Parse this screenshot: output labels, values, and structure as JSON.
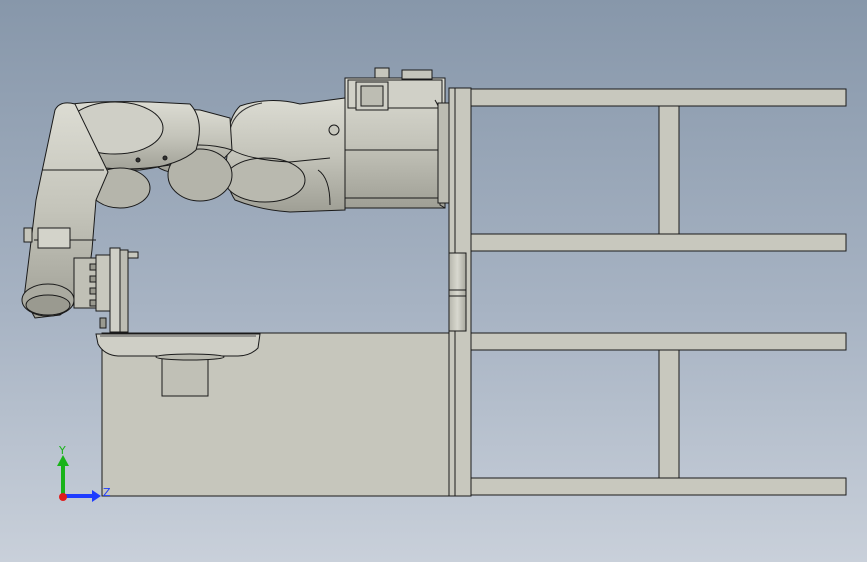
{
  "scene": {
    "description_free": true,
    "colors": {
      "background_top": "#8797aa",
      "background_bottom": "#c9d0da",
      "part_fill": "#c8c8be",
      "part_fill_light": "#d6d6cd",
      "part_shade": "#a9a99f",
      "edge": "#1a1a1a"
    }
  },
  "triad": {
    "y_label": "Y",
    "z_label": "Z",
    "y_color": "#19b319",
    "z_color": "#1e3cff",
    "x_color": "#e01c1c"
  }
}
